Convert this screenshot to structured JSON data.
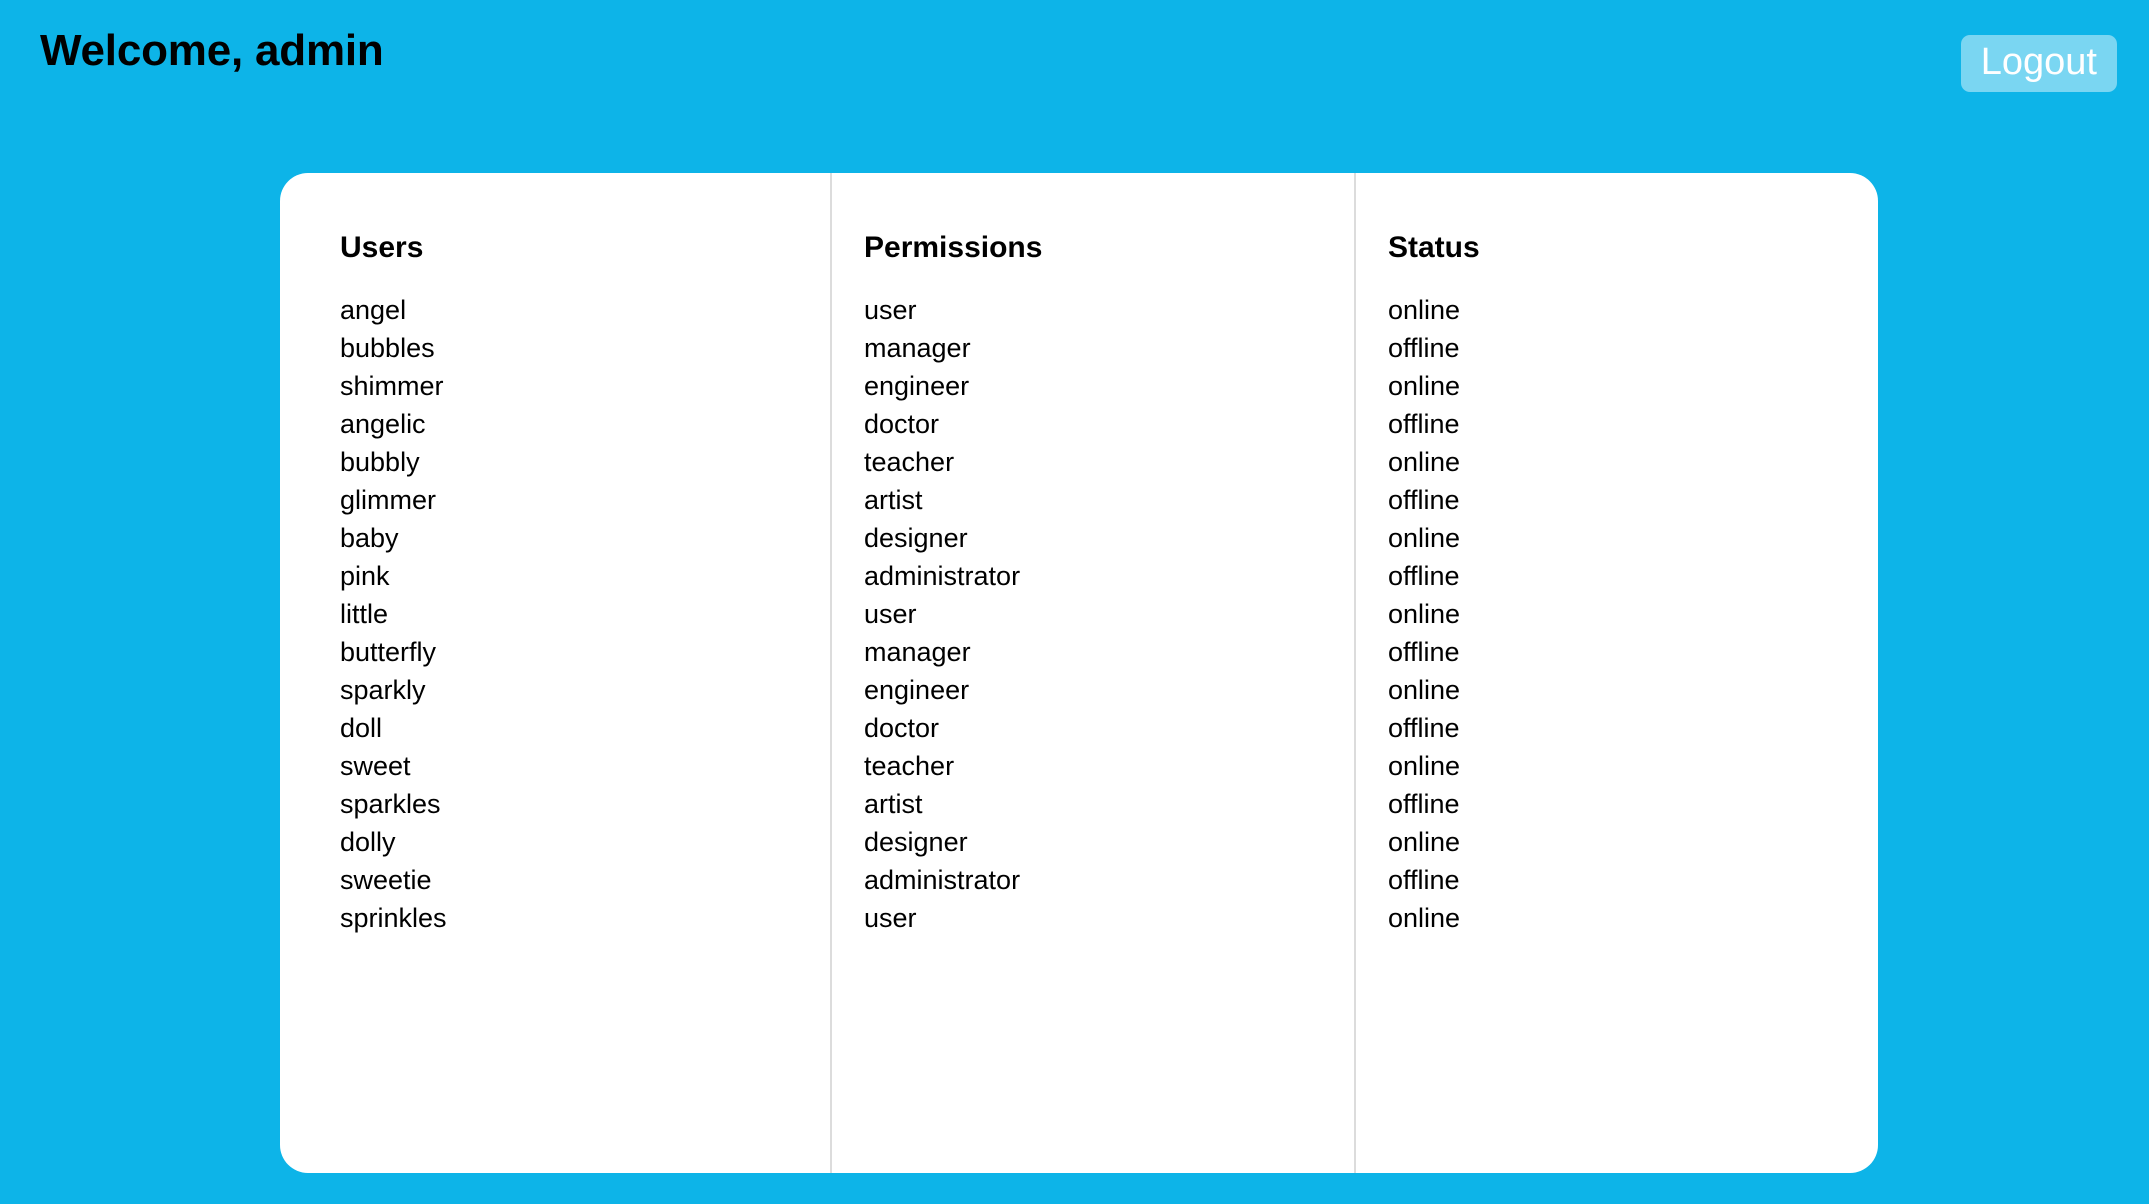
{
  "page": {
    "background_color": "#0db4e8",
    "card_background_color": "#ffffff",
    "divider_color": "#dcdcdc"
  },
  "header": {
    "title": "Welcome, admin",
    "logout_label": "Logout",
    "logout_text_color": "#ffffff",
    "title_color": "#000000"
  },
  "columns": [
    {
      "title": "Users",
      "items": [
        "angel",
        "bubbles",
        "shimmer",
        "angelic",
        "bubbly",
        "glimmer",
        "baby",
        "pink",
        "little",
        "butterfly",
        "sparkly",
        "doll",
        "sweet",
        "sparkles",
        "dolly",
        "sweetie",
        "sprinkles"
      ]
    },
    {
      "title": "Permissions",
      "items": [
        "user",
        "manager",
        "engineer",
        "doctor",
        "teacher",
        "artist",
        "designer",
        "administrator",
        "user",
        "manager",
        "engineer",
        "doctor",
        "teacher",
        "artist",
        "designer",
        "administrator",
        "user"
      ]
    },
    {
      "title": "Status",
      "items": [
        "online",
        "offline",
        "online",
        "offline",
        "online",
        "offline",
        "online",
        "offline",
        "online",
        "offline",
        "online",
        "offline",
        "online",
        "offline",
        "online",
        "offline",
        "online"
      ]
    }
  ]
}
